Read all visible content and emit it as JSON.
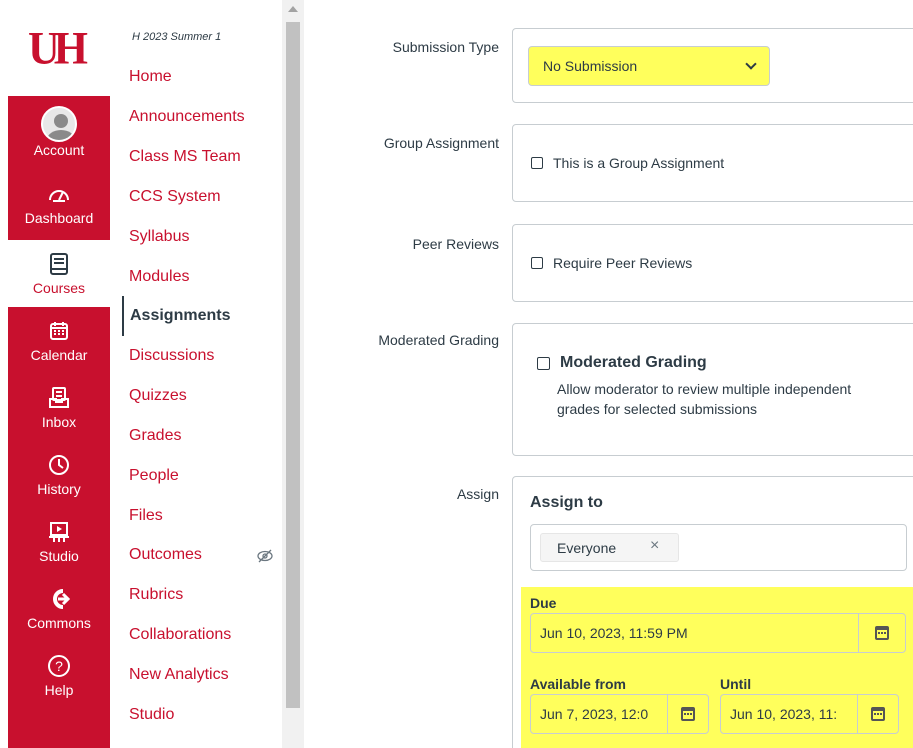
{
  "brand": {
    "logo_text": "UH",
    "accent": "#c8102e",
    "highlight": "#ffff5c"
  },
  "global_nav": [
    {
      "label": "Account",
      "icon": "user-avatar-icon"
    },
    {
      "label": "Dashboard",
      "icon": "dashboard-icon"
    },
    {
      "label": "Courses",
      "icon": "book-icon",
      "active": true
    },
    {
      "label": "Calendar",
      "icon": "calendar-icon"
    },
    {
      "label": "Inbox",
      "icon": "inbox-icon"
    },
    {
      "label": "History",
      "icon": "clock-icon"
    },
    {
      "label": "Studio",
      "icon": "studio-icon"
    },
    {
      "label": "Commons",
      "icon": "commons-icon"
    },
    {
      "label": "Help",
      "icon": "help-icon"
    }
  ],
  "course_nav": {
    "term": "H 2023 Summer 1",
    "items": [
      {
        "label": "Home"
      },
      {
        "label": "Announcements"
      },
      {
        "label": "Class MS Team"
      },
      {
        "label": "CCS System"
      },
      {
        "label": "Syllabus"
      },
      {
        "label": "Modules"
      },
      {
        "label": "Assignments",
        "active": true
      },
      {
        "label": "Discussions"
      },
      {
        "label": "Quizzes"
      },
      {
        "label": "Grades"
      },
      {
        "label": "People"
      },
      {
        "label": "Files"
      },
      {
        "label": "Outcomes",
        "hidden_icon": "eye-slash-icon"
      },
      {
        "label": "Rubrics"
      },
      {
        "label": "Collaborations"
      },
      {
        "label": "New Analytics"
      },
      {
        "label": "Studio"
      }
    ]
  },
  "form": {
    "submission_type": {
      "label": "Submission Type",
      "value": "No Submission"
    },
    "group_assignment": {
      "label": "Group Assignment",
      "checkbox": "This is a Group Assignment",
      "checked": false
    },
    "peer_reviews": {
      "label": "Peer Reviews",
      "checkbox": "Require Peer Reviews",
      "checked": false
    },
    "moderated_grading": {
      "label": "Moderated Grading",
      "checkbox": "Moderated Grading",
      "description": "Allow moderator to review multiple independent grades for selected submissions",
      "checked": false
    },
    "assign": {
      "label": "Assign",
      "assign_to_label": "Assign to",
      "token": "Everyone",
      "token_remove": "×",
      "due_label": "Due",
      "due_value": "Jun 10, 2023, 11:59 PM",
      "available_from_label": "Available from",
      "available_from_value": "Jun 7, 2023, 12:0",
      "until_label": "Until",
      "until_value": "Jun 10, 2023, 11:"
    }
  }
}
